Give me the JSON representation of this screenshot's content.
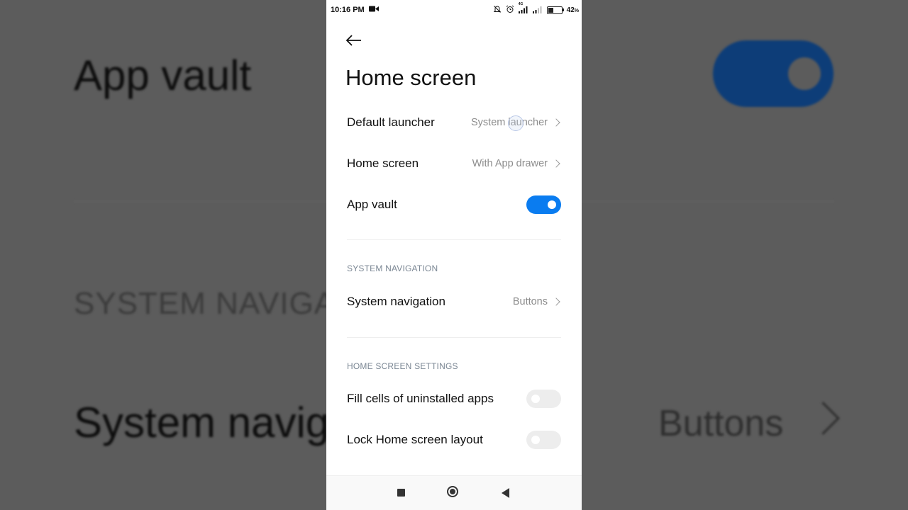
{
  "status_bar": {
    "time": "10:16 PM",
    "network": "4G",
    "battery_text": "42",
    "battery_percent_symbol": "%",
    "battery_level": 0.42
  },
  "header": {
    "title": "Home screen"
  },
  "settings": {
    "default_launcher": {
      "label": "Default launcher",
      "value": "System launcher"
    },
    "home_screen": {
      "label": "Home screen",
      "value": "With App drawer"
    },
    "app_vault": {
      "label": "App vault",
      "enabled": true
    }
  },
  "system_navigation_section": {
    "header": "SYSTEM NAVIGATION",
    "item": {
      "label": "System navigation",
      "value": "Buttons"
    }
  },
  "home_screen_settings_section": {
    "header": "HOME SCREEN SETTINGS",
    "fill_cells": {
      "label": "Fill cells of uninstalled apps",
      "enabled": false
    },
    "lock_layout": {
      "label": "Lock Home screen layout",
      "enabled": false
    }
  },
  "background_zoom": {
    "app_vault": "App vault",
    "system_navigation_header": "SYSTEM NAVIGATION",
    "system_navigation": "System navigation",
    "buttons": "Buttons"
  },
  "colors": {
    "accent": "#0a7cf0",
    "background_dim": "#5c5c5c",
    "section_header": "#7b8794",
    "secondary_text": "#8c8c8c"
  },
  "icons": {
    "back": "arrow-left-icon",
    "chevron": "chevron-right-icon",
    "video": "video-camera-icon",
    "mute": "bell-off-icon",
    "alarm": "alarm-clock-icon",
    "signal": "signal-bars-icon",
    "battery": "battery-icon",
    "nav_recent": "square-icon",
    "nav_home": "circle-icon",
    "nav_back": "triangle-back-icon"
  }
}
